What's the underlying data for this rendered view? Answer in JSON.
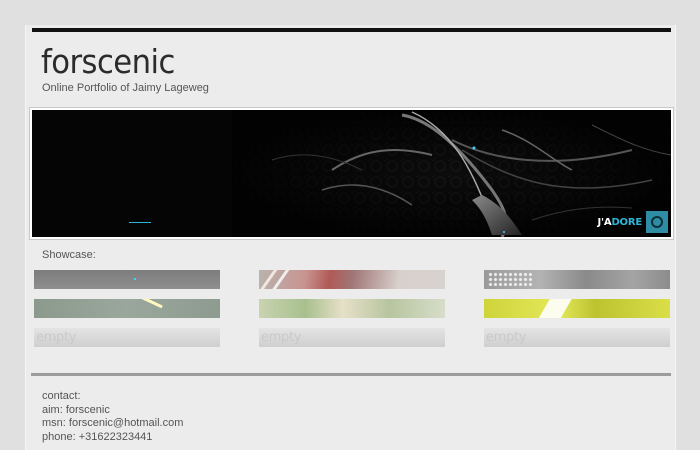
{
  "site": {
    "logo_text": "forscenic",
    "tagline": "Online Portfolio of Jaimy Lageweg"
  },
  "banner": {
    "badge_prefix": "J'A",
    "badge_suffix": "DORE"
  },
  "showcase": {
    "label": "Showcase:",
    "empty_label": "empty"
  },
  "contact": {
    "heading": "contact:",
    "aim": "aim: forscenic",
    "msn": "msn: forscenic@hotmail.com",
    "phone": "phone: +31622323441"
  },
  "colors": {
    "top_bar": "#111111",
    "page_bg": "#ececec",
    "outer_bg": "#e0e0e0",
    "badge_accent": "#2fb6d6"
  }
}
